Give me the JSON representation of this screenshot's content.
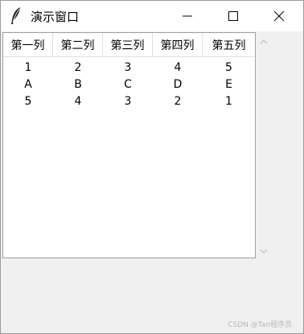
{
  "window": {
    "title": "演示窗口",
    "app_icon": "feather-icon",
    "controls": [
      "minimize-icon",
      "maximize-icon",
      "close-icon"
    ]
  },
  "table": {
    "headers": [
      "第一列",
      "第二列",
      "第三列",
      "第四列",
      "第五列"
    ],
    "rows": [
      [
        "1",
        "2",
        "3",
        "4",
        "5"
      ],
      [
        "A",
        "B",
        "C",
        "D",
        "E"
      ],
      [
        "5",
        "4",
        "3",
        "2",
        "1"
      ]
    ]
  },
  "scrollbar": {
    "up_icon": "chevron-up-icon",
    "down_icon": "chevron-down-icon"
  },
  "watermark": "CSDN @Tan程序员"
}
